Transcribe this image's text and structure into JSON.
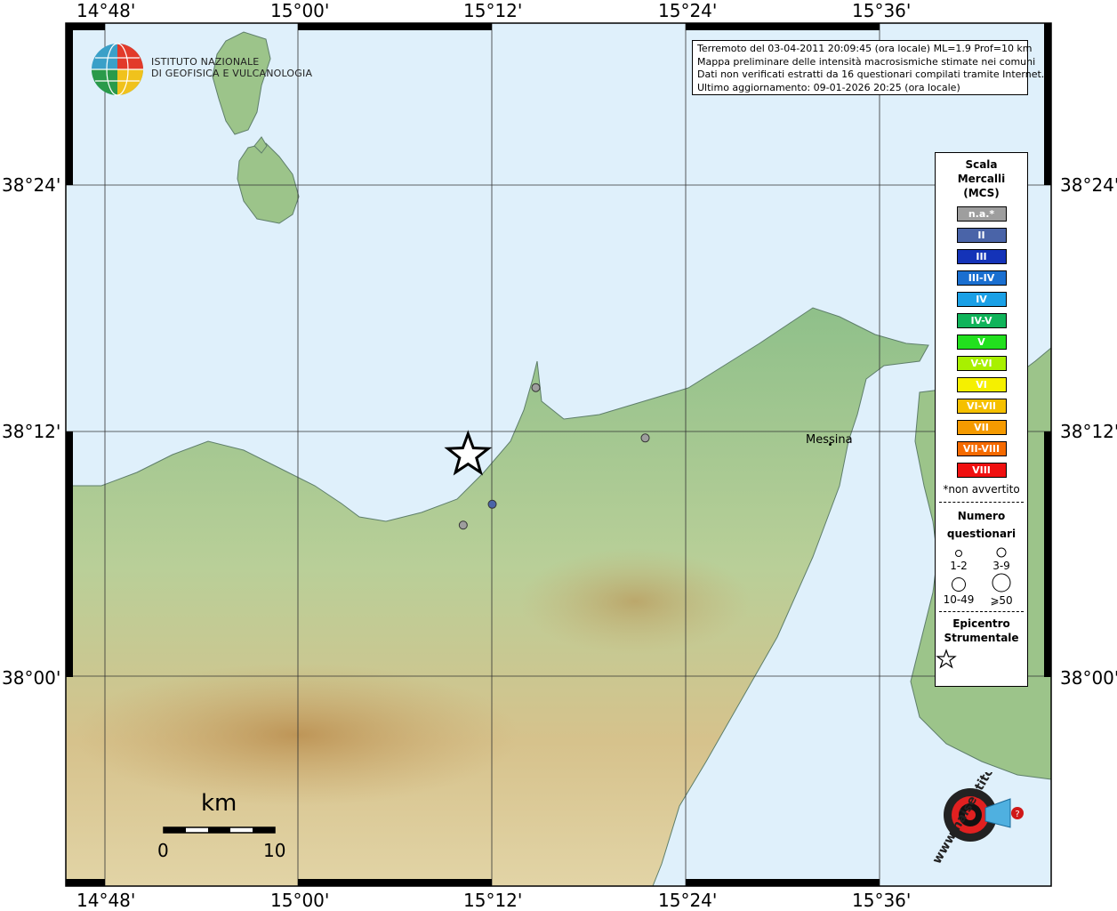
{
  "header": {
    "logo_line1": "ISTITUTO NAZIONALE",
    "logo_line2": "DI GEOFISICA E VULCANOLOGIA"
  },
  "info": {
    "line1": "Terremoto del 03-04-2011 20:09:45 (ora locale) ML=1.9 Prof=10 km",
    "line2": "Mappa preliminare delle intensità macrosismiche stimate nei comuni",
    "line3": "Dati non verificati estratti da 16 questionari compilati tramite Internet.",
    "line4": "Ultimo aggiornamento: 09-01-2026 20:25 (ora locale)"
  },
  "axes": {
    "lon_labels": [
      "14°48'",
      "15°00'",
      "15°12'",
      "15°24'",
      "15°36'"
    ],
    "lat_labels": [
      "38°24'",
      "38°12'",
      "38°00'"
    ]
  },
  "places": {
    "messina": "Messina"
  },
  "legend": {
    "title1": "Scala",
    "title2": "Mercalli",
    "title3": "(MCS)",
    "classes": [
      {
        "label": "n.a.*",
        "color": "#9e9e9e"
      },
      {
        "label": "II",
        "color": "#4a64a8"
      },
      {
        "label": "III",
        "color": "#1433b8"
      },
      {
        "label": "III-IV",
        "color": "#1a6fd0"
      },
      {
        "label": "IV",
        "color": "#1aa0e6"
      },
      {
        "label": "IV-V",
        "color": "#10b45a"
      },
      {
        "label": "V",
        "color": "#22e01e"
      },
      {
        "label": "V-VI",
        "color": "#a8f000"
      },
      {
        "label": "VI",
        "color": "#f5f000"
      },
      {
        "label": "VI-VII",
        "color": "#f5c000"
      },
      {
        "label": "VII",
        "color": "#f59a00"
      },
      {
        "label": "VII-VIII",
        "color": "#f56a00"
      },
      {
        "label": "VIII",
        "color": "#f01010"
      }
    ],
    "note": "*non avvertito",
    "count_title1": "Numero",
    "count_title2": "questionari",
    "count_classes": [
      "1-2",
      "3-9",
      "10-49",
      "⩾50"
    ],
    "epi_title1": "Epicentro",
    "epi_title2": "Strumentale"
  },
  "scale_bar": {
    "unit": "km",
    "start": "0",
    "end": "10"
  },
  "brand": {
    "text": "www.haisentitoilterremoto.it"
  },
  "observations": [
    {
      "lon": 15.245,
      "lat": 38.235,
      "class": "n.a.*",
      "questionari": "1-2"
    },
    {
      "lon": 15.358,
      "lat": 38.194,
      "class": "n.a.*",
      "questionari": "1-2"
    },
    {
      "lon": 15.17,
      "lat": 38.123,
      "class": "n.a.*",
      "questionari": "1-2"
    },
    {
      "lon": 15.2,
      "lat": 38.14,
      "class": "II",
      "questionari": "1-2"
    }
  ],
  "epicenter": {
    "lon": 15.175,
    "lat": 38.18
  }
}
